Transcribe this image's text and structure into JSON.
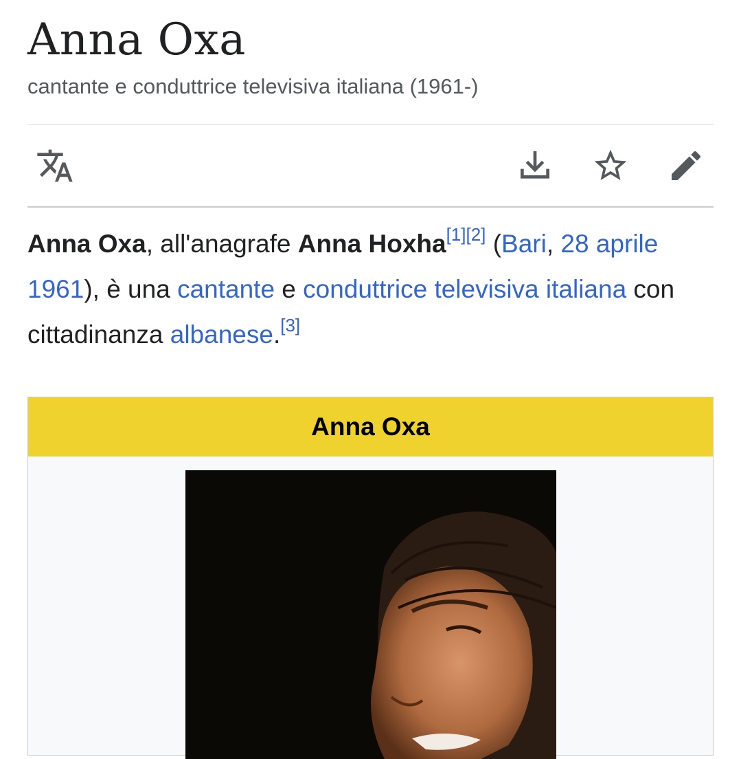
{
  "page": {
    "title": "Anna Oxa",
    "subtitle": "cantante e conduttrice televisiva italiana (1961-)"
  },
  "toolbar": {
    "icons": [
      "translate-icon",
      "download-icon",
      "star-icon",
      "edit-icon"
    ]
  },
  "lead": {
    "name_bold": "Anna Oxa",
    "text_1": ", all'anagrafe ",
    "birthname_bold": "Anna Hoxha",
    "ref_1": "[1]",
    "ref_2": "[2]",
    "text_2": " (",
    "link_bari": "Bari",
    "text_3": ", ",
    "link_date": "28 aprile",
    "text_4": " ",
    "link_year": "1961",
    "text_5": "), è una ",
    "link_cantante": "cantante",
    "text_6": " e ",
    "link_conduttrice": "conduttrice televisiva italiana",
    "text_7": " con cittadinanza ",
    "link_albanese": "albanese",
    "text_8": ".",
    "ref_3": "[3]"
  },
  "infobox": {
    "title": "Anna Oxa",
    "header_color": "#f0d22e"
  },
  "colors": {
    "link": "#3366cc",
    "text": "#202122",
    "muted": "#54595d"
  }
}
